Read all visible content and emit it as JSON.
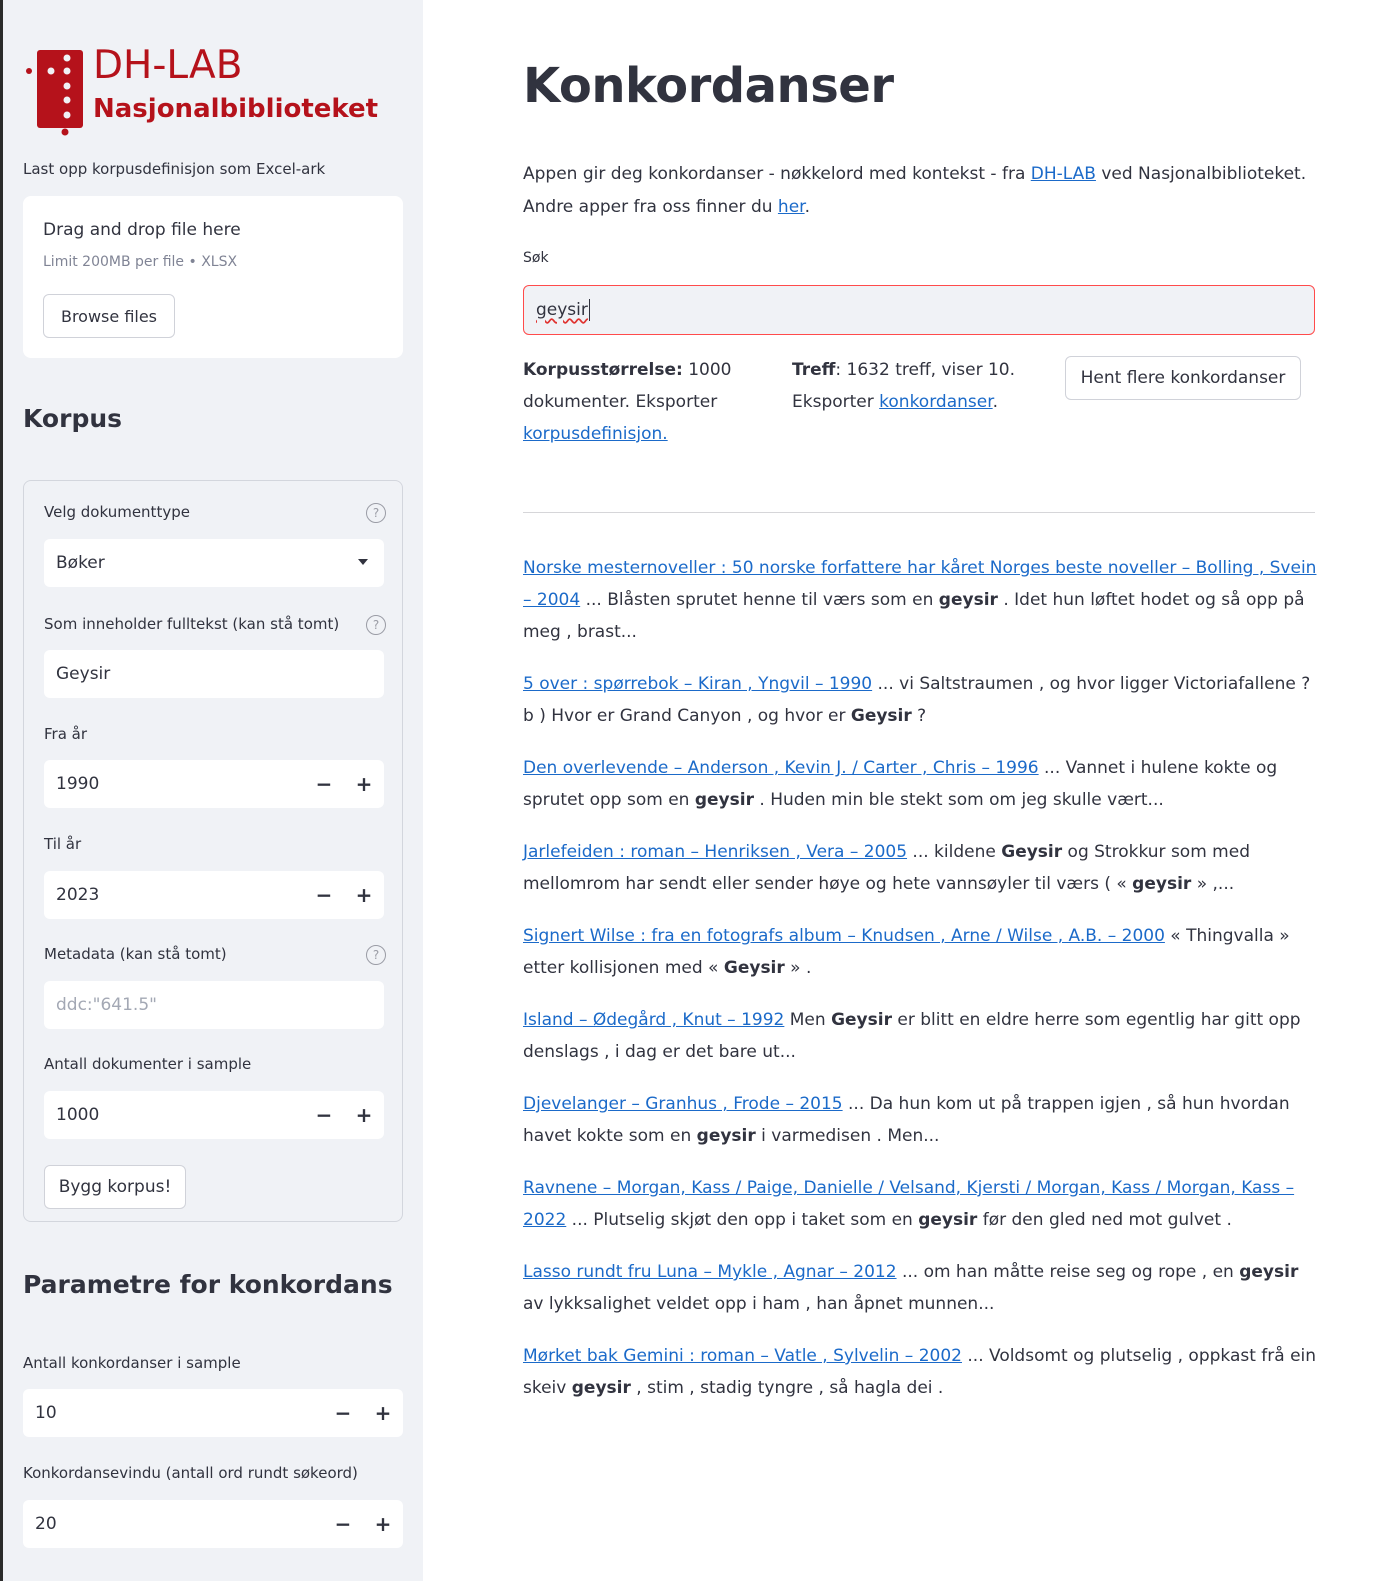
{
  "logo": {
    "top": "DH-LAB",
    "bottom": "Nasjonalbiblioteket"
  },
  "sidebar": {
    "upload_label": "Last opp korpusdefinisjon som Excel-ark",
    "uploader_title": "Drag and drop file here",
    "uploader_sub": "Limit 200MB per file • XLSX",
    "browse_label": "Browse files",
    "korpus_heading": "Korpus",
    "doctype_label": "Velg dokumenttype",
    "doctype_value": "Bøker",
    "fulltext_label": "Som inneholder fulltekst (kan stå tomt)",
    "fulltext_value": "Geysir",
    "from_label": "Fra år",
    "from_value": "1990",
    "to_label": "Til år",
    "to_value": "2023",
    "meta_label": "Metadata (kan stå tomt)",
    "meta_placeholder": "ddc:\"641.5\"",
    "ndocs_label": "Antall dokumenter i sample",
    "ndocs_value": "1000",
    "build_label": "Bygg korpus!",
    "params_heading": "Parametre for konkordans",
    "nconc_label": "Antall konkordanser i sample",
    "nconc_value": "10",
    "window_label": "Konkordansevindu (antall ord rundt søkeord)",
    "window_value": "20",
    "help_symbol": "?",
    "minus": "−",
    "plus": "+"
  },
  "main": {
    "title": "Konkordanser",
    "intro_pre": "Appen gir deg konkordanser - nøkkelord med kontekst - fra ",
    "intro_link1": "DH-LAB",
    "intro_mid": " ved Nasjonalbiblioteket. Andre apper fra oss finner du ",
    "intro_link2": "her",
    "intro_end": ".",
    "search_label": "Søk",
    "search_value": "geysir",
    "corpus_size_bold": "Korpusstørrelse:",
    "corpus_size_text": " 1000 dokumenter. Eksporter ",
    "corpus_link": "korpusdefinisjon.",
    "hits_bold": "Treff",
    "hits_text": ": 1632 treff, viser 10. Eksporter ",
    "hits_link": "konkordanser",
    "hits_end": ".",
    "more_button": "Hent flere konkordanser"
  },
  "results": [
    {
      "link": "Norske mesternoveller : 50 norske forfattere har kåret Norges beste noveller – Bolling , Svein – 2004",
      "pre": " ... Blåsten sprutet henne til værs som en ",
      "kw": "geysir",
      "post": " . Idet hun løftet hodet og så opp på meg , brast..."
    },
    {
      "link": "5 over : spørrebok – Kiran , Yngvil – 1990",
      "pre": " ... vi Saltstraumen , og hvor ligger Victoriafallene ? b ) Hvor er Grand Canyon , og hvor er ",
      "kw": "Geysir",
      "post": " ?"
    },
    {
      "link": "Den overlevende – Anderson , Kevin J. / Carter , Chris – 1996",
      "pre": " ... Vannet i hulene kokte og sprutet opp som en ",
      "kw": "geysir",
      "post": " . Huden min ble stekt som om jeg skulle vært..."
    },
    {
      "link": "Jarlefeiden : roman – Henriksen , Vera – 2005",
      "pre": " ... kildene ",
      "kw": "Geysir",
      "post": " og Strokkur som med mellomrom har sendt eller sender høye og hete vannsøyler til værs ( « ",
      "kw2": "geysir",
      "post2": " » ,..."
    },
    {
      "link": "Signert Wilse : fra en fotografs album – Knudsen , Arne / Wilse , A.B. – 2000",
      "pre": " « Thingvalla » etter kollisjonen med « ",
      "kw": "Geysir",
      "post": " » ."
    },
    {
      "link": "Island – Ødegård , Knut – 1992",
      "pre": " Men ",
      "kw": "Geysir",
      "post": " er blitt en eldre herre som egentlig har gitt opp denslags , i dag er det bare ut..."
    },
    {
      "link": "Djevelanger – Granhus , Frode – 2015",
      "pre": " ... Da hun kom ut på trappen igjen , så hun hvordan havet kokte som en ",
      "kw": "geysir",
      "post": " i varmedisen . Men..."
    },
    {
      "link": "Ravnene – Morgan, Kass / Paige, Danielle / Velsand, Kjersti / Morgan, Kass / Morgan, Kass – 2022",
      "pre": " ... Plutselig skjøt den opp i taket som en ",
      "kw": "geysir",
      "post": " før den gled ned mot gulvet ."
    },
    {
      "link": "Lasso rundt fru Luna – Mykle , Agnar – 2012",
      "pre": " ... om han måtte reise seg og rope , en ",
      "kw": "geysir",
      "post": " av lykksalighet veldet opp i ham , han åpnet munnen..."
    },
    {
      "link": "Mørket bak Gemini : roman – Vatle , Sylvelin – 2002",
      "pre": " ... Voldsomt og plutselig , oppkast frå ein skeiv ",
      "kw": "geysir",
      "post": " , stim , stadig tyngre , så hagla dei ."
    }
  ],
  "colors": {
    "brand": "#b5121b",
    "link": "#1b6ac9",
    "focus": "#ff4b4b",
    "sidebar_bg": "#f0f2f6"
  }
}
